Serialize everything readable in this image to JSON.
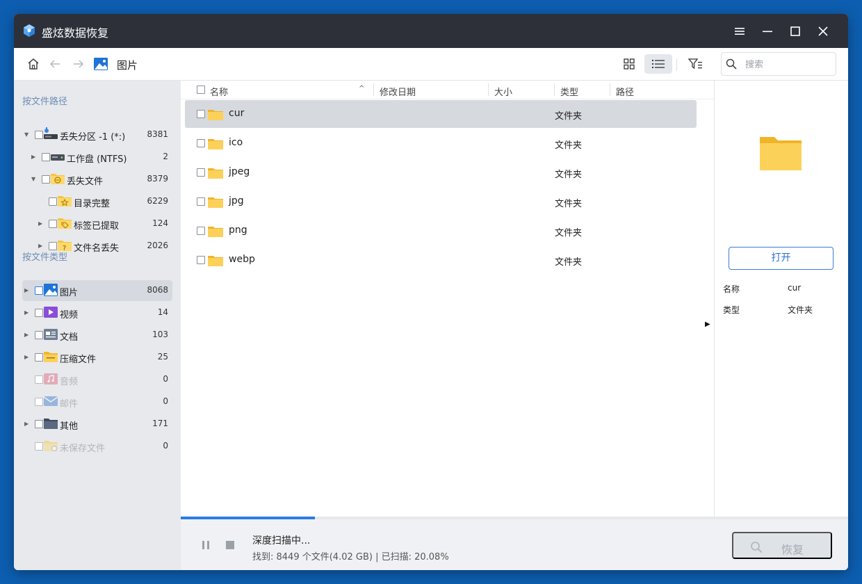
{
  "app": {
    "title": "盛炫数据恢复"
  },
  "toolbar": {
    "breadcrumb": "图片",
    "search_placeholder": "搜索",
    "active_view": "list"
  },
  "sidebar": {
    "section_path": "按文件路径",
    "path_items": [
      {
        "label": "丢失分区 -1 (*:)",
        "count": "8381",
        "expanded": true,
        "icon": "drive-icon"
      },
      {
        "label": "工作盘 (NTFS)",
        "count": "2",
        "expanded": false,
        "icon": "disk-icon"
      },
      {
        "label": "丢失文件",
        "count": "8379",
        "expanded": true,
        "icon": "lost-folder-icon"
      },
      {
        "label": "目录完整",
        "count": "6229",
        "icon": "star-folder-icon"
      },
      {
        "label": "标签已提取",
        "count": "124",
        "expanded": false,
        "icon": "tag-folder-icon"
      },
      {
        "label": "文件名丢失",
        "count": "2026",
        "expanded": false,
        "icon": "question-folder-icon"
      }
    ],
    "section_type": "按文件类型",
    "type_items": [
      {
        "label": "图片",
        "count": "8068",
        "selected": true,
        "icon": "picture-icon"
      },
      {
        "label": "视频",
        "count": "14",
        "icon": "video-icon"
      },
      {
        "label": "文档",
        "count": "103",
        "icon": "document-icon"
      },
      {
        "label": "压缩文件",
        "count": "25",
        "icon": "archive-icon"
      },
      {
        "label": "音频",
        "count": "0",
        "disabled": true,
        "icon": "audio-icon"
      },
      {
        "label": "邮件",
        "count": "0",
        "disabled": true,
        "icon": "mail-icon"
      },
      {
        "label": "其他",
        "count": "171",
        "icon": "other-icon"
      },
      {
        "label": "未保存文件",
        "count": "0",
        "disabled": true,
        "icon": "unsaved-icon"
      }
    ]
  },
  "table": {
    "columns": [
      "名称",
      "修改日期",
      "大小",
      "类型",
      "路径"
    ],
    "rows": [
      {
        "name": "cur",
        "type": "文件夹"
      },
      {
        "name": "ico",
        "type": "文件夹"
      },
      {
        "name": "jpeg",
        "type": "文件夹"
      },
      {
        "name": "jpg",
        "type": "文件夹"
      },
      {
        "name": "png",
        "type": "文件夹"
      },
      {
        "name": "webp",
        "type": "文件夹"
      }
    ]
  },
  "preview": {
    "open_label": "打开",
    "name_key": "名称",
    "name_value": "cur",
    "type_key": "类型",
    "type_value": "文件夹"
  },
  "status": {
    "scan_title": "深度扫描中...",
    "scan_detail": "找到: 8449 个文件(4.02 GB) | 已扫描: 20.08%",
    "progress_fraction": 0.2008,
    "recover_label": "恢复"
  },
  "colors": {
    "titlebar": "#2d3039",
    "accent": "#2b7de0",
    "sidebar_bg": "#e7e9ec",
    "folder": "#f5c542"
  }
}
